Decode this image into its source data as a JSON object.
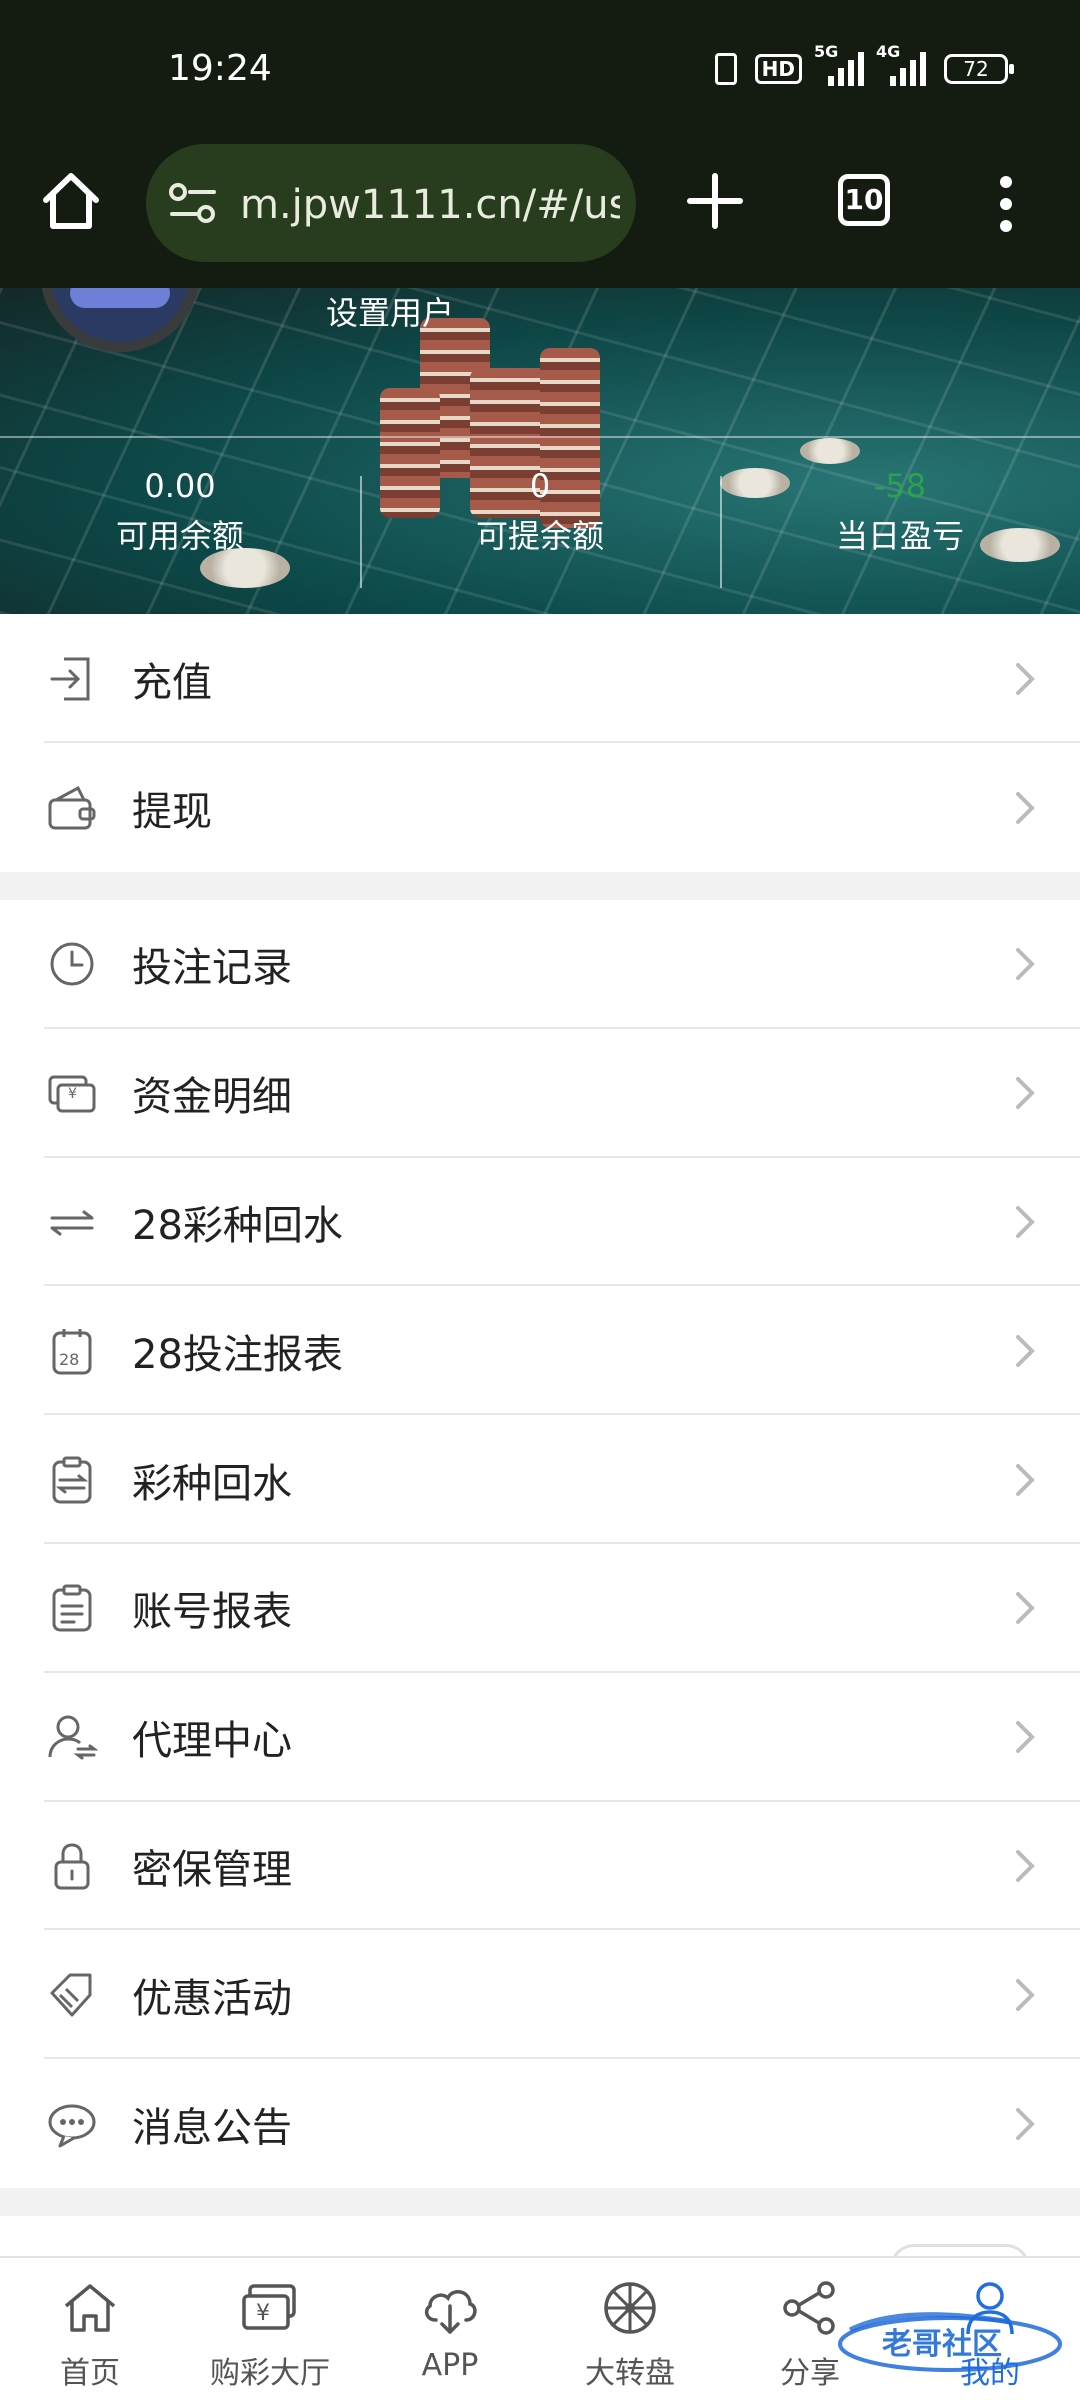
{
  "status_bar": {
    "time": "19:24",
    "hd_label": "HD",
    "net_5g": "5G",
    "net_4g": "4G",
    "battery": "72"
  },
  "browser": {
    "url": "m.jpw1111.cn/#/user",
    "tab_count": "10"
  },
  "profile": {
    "set_user_label": "设置用户",
    "stats": [
      {
        "value": "0.00",
        "label": "可用余额"
      },
      {
        "value": "0",
        "label": "可提余额"
      },
      {
        "value": "-58",
        "label": "当日盈亏"
      }
    ]
  },
  "menu_group_1": [
    {
      "label": "充值",
      "icon": "deposit-icon"
    },
    {
      "label": "提现",
      "icon": "wallet-icon"
    }
  ],
  "menu_group_2": [
    {
      "label": "投注记录",
      "icon": "clock-icon"
    },
    {
      "label": "资金明细",
      "icon": "yuan-bills-icon"
    },
    {
      "label": "28彩种回水",
      "icon": "exchange-arrows-icon"
    },
    {
      "label": "28投注报表",
      "icon": "calendar-28-icon"
    },
    {
      "label": "彩种回水",
      "icon": "clipboard-exchange-icon"
    },
    {
      "label": "账号报表",
      "icon": "clipboard-icon"
    },
    {
      "label": "代理中心",
      "icon": "user-agent-icon"
    },
    {
      "label": "密保管理",
      "icon": "lock-icon"
    },
    {
      "label": "优惠活动",
      "icon": "tag-icon"
    },
    {
      "label": "消息公告",
      "icon": "chat-bubble-icon"
    }
  ],
  "bottom_nav": [
    {
      "label": "首页",
      "icon": "home-icon"
    },
    {
      "label": "购彩大厅",
      "icon": "lottery-hall-icon"
    },
    {
      "label": "APP",
      "icon": "cloud-download-icon"
    },
    {
      "label": "大转盘",
      "icon": "wheel-icon"
    },
    {
      "label": "分享",
      "icon": "share-icon"
    },
    {
      "label": "我的",
      "icon": "user-icon"
    }
  ],
  "colors": {
    "browser_bg": "#141c12",
    "url_bar_bg": "#283d1e",
    "active_nav": "#1f6fe0",
    "loss_value": "#2aa34a"
  }
}
